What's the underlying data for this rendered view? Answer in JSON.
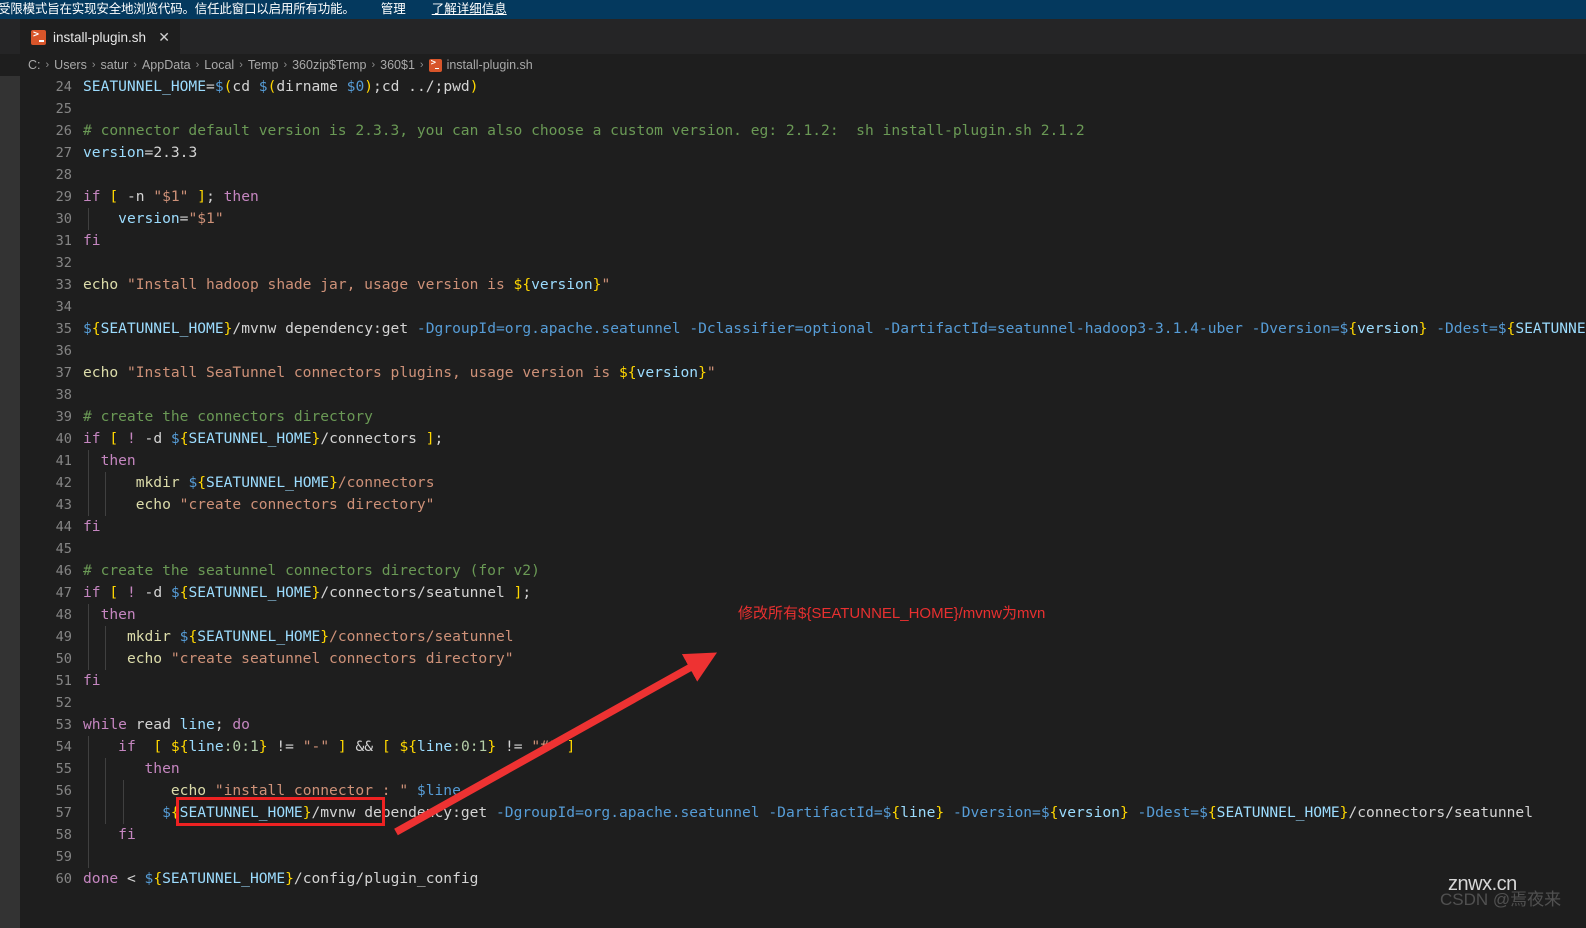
{
  "banner": {
    "message": "受限模式旨在实现安全地浏览代码。信任此窗口以启用所有功能。",
    "manage_label": "管理",
    "learn_more_label": "了解详细信息",
    "background_color": "#04395e"
  },
  "tab": {
    "label": "install-plugin.sh",
    "close_label": "✕",
    "icon": "shell-script-icon"
  },
  "breadcrumbs": {
    "separator": "›",
    "items": [
      {
        "label": "C:"
      },
      {
        "label": "Users"
      },
      {
        "label": "satur"
      },
      {
        "label": "AppData"
      },
      {
        "label": "Local"
      },
      {
        "label": "Temp"
      },
      {
        "label": "360zip$Temp"
      },
      {
        "label": "360$1"
      },
      {
        "label": "install-plugin.sh"
      }
    ]
  },
  "editor": {
    "first_line_number": 24,
    "background_color": "#1e1e1e",
    "lines": [
      {
        "n": 24,
        "tokens": [
          {
            "t": "SEATUNNEL_HOME",
            "c": "t-var"
          },
          {
            "t": "=",
            "c": "t-op"
          },
          {
            "t": "$",
            "c": "t-builtin"
          },
          {
            "t": "(",
            "c": "t-punc"
          },
          {
            "t": "cd ",
            "c": "t-def"
          },
          {
            "t": "$",
            "c": "t-builtin"
          },
          {
            "t": "(",
            "c": "t-punc"
          },
          {
            "t": "dirname ",
            "c": "t-def"
          },
          {
            "t": "$0",
            "c": "t-builtin"
          },
          {
            "t": ")",
            "c": "t-punc"
          },
          {
            "t": ";cd ../;pwd",
            "c": "t-def"
          },
          {
            "t": ")",
            "c": "t-punc"
          }
        ]
      },
      {
        "n": 25,
        "tokens": []
      },
      {
        "n": 26,
        "tokens": [
          {
            "t": "# connector default version is 2.3.3, you can also choose a custom version. eg: 2.1.2:  sh install-plugin.sh 2.1.2",
            "c": "t-cmt"
          }
        ]
      },
      {
        "n": 27,
        "tokens": [
          {
            "t": "version",
            "c": "t-var"
          },
          {
            "t": "=",
            "c": "t-op"
          },
          {
            "t": "2.3.3",
            "c": "t-def"
          }
        ]
      },
      {
        "n": 28,
        "tokens": []
      },
      {
        "n": 29,
        "tokens": [
          {
            "t": "if ",
            "c": "t-kw"
          },
          {
            "t": "[",
            "c": "t-punc"
          },
          {
            "t": " -n ",
            "c": "t-def"
          },
          {
            "t": "\"$1\"",
            "c": "t-str"
          },
          {
            "t": " ",
            "c": "t-def"
          },
          {
            "t": "]",
            "c": "t-punc"
          },
          {
            "t": "; ",
            "c": "t-def"
          },
          {
            "t": "then",
            "c": "t-kw"
          }
        ]
      },
      {
        "n": 30,
        "guides": [
          0
        ],
        "tokens": [
          {
            "t": "    ",
            "c": "t-def"
          },
          {
            "t": "version",
            "c": "t-var"
          },
          {
            "t": "=",
            "c": "t-op"
          },
          {
            "t": "\"$1\"",
            "c": "t-str"
          }
        ]
      },
      {
        "n": 31,
        "tokens": [
          {
            "t": "fi",
            "c": "t-kw"
          }
        ]
      },
      {
        "n": 32,
        "tokens": []
      },
      {
        "n": 33,
        "tokens": [
          {
            "t": "echo",
            "c": "t-fn"
          },
          {
            "t": " ",
            "c": "t-def"
          },
          {
            "t": "\"Install hadoop shade jar, usage version is ",
            "c": "t-str"
          },
          {
            "t": "${",
            "c": "t-punc"
          },
          {
            "t": "version",
            "c": "t-var"
          },
          {
            "t": "}",
            "c": "t-punc"
          },
          {
            "t": "\"",
            "c": "t-str"
          }
        ]
      },
      {
        "n": 34,
        "tokens": []
      },
      {
        "n": 35,
        "tokens": [
          {
            "t": "$",
            "c": "t-builtin"
          },
          {
            "t": "{",
            "c": "t-punc"
          },
          {
            "t": "SEATUNNEL_HOME",
            "c": "t-var"
          },
          {
            "t": "}",
            "c": "t-punc"
          },
          {
            "t": "/mvnw dependency:get ",
            "c": "t-def"
          },
          {
            "t": "-DgroupId=org.apache.seatunnel",
            "c": "t-builtin"
          },
          {
            "t": " ",
            "c": "t-def"
          },
          {
            "t": "-Dclassifier=optional",
            "c": "t-builtin"
          },
          {
            "t": " ",
            "c": "t-def"
          },
          {
            "t": "-DartifactId=seatunnel-hadoop3-3.1.4-uber",
            "c": "t-builtin"
          },
          {
            "t": " ",
            "c": "t-def"
          },
          {
            "t": "-Dversion=",
            "c": "t-builtin"
          },
          {
            "t": "$",
            "c": "t-builtin"
          },
          {
            "t": "{",
            "c": "t-punc"
          },
          {
            "t": "version",
            "c": "t-var"
          },
          {
            "t": "}",
            "c": "t-punc"
          },
          {
            "t": " ",
            "c": "t-def"
          },
          {
            "t": "-Ddest=",
            "c": "t-builtin"
          },
          {
            "t": "$",
            "c": "t-builtin"
          },
          {
            "t": "{",
            "c": "t-punc"
          },
          {
            "t": "SEATUNNE",
            "c": "t-var"
          }
        ]
      },
      {
        "n": 36,
        "tokens": []
      },
      {
        "n": 37,
        "tokens": [
          {
            "t": "echo",
            "c": "t-fn"
          },
          {
            "t": " ",
            "c": "t-def"
          },
          {
            "t": "\"Install SeaTunnel connectors plugins, usage version is ",
            "c": "t-str"
          },
          {
            "t": "${",
            "c": "t-punc"
          },
          {
            "t": "version",
            "c": "t-var"
          },
          {
            "t": "}",
            "c": "t-punc"
          },
          {
            "t": "\"",
            "c": "t-str"
          }
        ]
      },
      {
        "n": 38,
        "tokens": []
      },
      {
        "n": 39,
        "tokens": [
          {
            "t": "# create the connectors directory",
            "c": "t-cmt"
          }
        ]
      },
      {
        "n": 40,
        "tokens": [
          {
            "t": "if ",
            "c": "t-kw"
          },
          {
            "t": "[",
            "c": "t-punc"
          },
          {
            "t": " ",
            "c": "t-def"
          },
          {
            "t": "!",
            "c": "t-kw"
          },
          {
            "t": " -d ",
            "c": "t-def"
          },
          {
            "t": "$",
            "c": "t-builtin"
          },
          {
            "t": "{",
            "c": "t-punc"
          },
          {
            "t": "SEATUNNEL_HOME",
            "c": "t-var"
          },
          {
            "t": "}",
            "c": "t-punc"
          },
          {
            "t": "/connectors ",
            "c": "t-def"
          },
          {
            "t": "]",
            "c": "t-punc"
          },
          {
            "t": ";",
            "c": "t-def"
          }
        ]
      },
      {
        "n": 41,
        "guides": [
          0
        ],
        "tokens": [
          {
            "t": "  ",
            "c": "t-def"
          },
          {
            "t": "then",
            "c": "t-kw"
          }
        ]
      },
      {
        "n": 42,
        "guides": [
          0,
          1
        ],
        "tokens": [
          {
            "t": "      ",
            "c": "t-def"
          },
          {
            "t": "mkdir",
            "c": "t-fn"
          },
          {
            "t": " ",
            "c": "t-def"
          },
          {
            "t": "$",
            "c": "t-builtin"
          },
          {
            "t": "{",
            "c": "t-punc"
          },
          {
            "t": "SEATUNNEL_HOME",
            "c": "t-var"
          },
          {
            "t": "}",
            "c": "t-punc"
          },
          {
            "t": "/connectors",
            "c": "t-str"
          }
        ]
      },
      {
        "n": 43,
        "guides": [
          0,
          1
        ],
        "tokens": [
          {
            "t": "      ",
            "c": "t-def"
          },
          {
            "t": "echo",
            "c": "t-fn"
          },
          {
            "t": " ",
            "c": "t-def"
          },
          {
            "t": "\"create connectors directory\"",
            "c": "t-str"
          }
        ]
      },
      {
        "n": 44,
        "tokens": [
          {
            "t": "fi",
            "c": "t-kw"
          }
        ]
      },
      {
        "n": 45,
        "tokens": []
      },
      {
        "n": 46,
        "tokens": [
          {
            "t": "# create the seatunnel connectors directory (for v2)",
            "c": "t-cmt"
          }
        ]
      },
      {
        "n": 47,
        "tokens": [
          {
            "t": "if ",
            "c": "t-kw"
          },
          {
            "t": "[",
            "c": "t-punc"
          },
          {
            "t": " ",
            "c": "t-def"
          },
          {
            "t": "!",
            "c": "t-kw"
          },
          {
            "t": " -d ",
            "c": "t-def"
          },
          {
            "t": "$",
            "c": "t-builtin"
          },
          {
            "t": "{",
            "c": "t-punc"
          },
          {
            "t": "SEATUNNEL_HOME",
            "c": "t-var"
          },
          {
            "t": "}",
            "c": "t-punc"
          },
          {
            "t": "/connectors/seatunnel ",
            "c": "t-def"
          },
          {
            "t": "]",
            "c": "t-punc"
          },
          {
            "t": ";",
            "c": "t-def"
          }
        ]
      },
      {
        "n": 48,
        "guides": [
          0
        ],
        "tokens": [
          {
            "t": "  ",
            "c": "t-def"
          },
          {
            "t": "then",
            "c": "t-kw"
          }
        ]
      },
      {
        "n": 49,
        "guides": [
          0,
          1
        ],
        "tokens": [
          {
            "t": "     ",
            "c": "t-def"
          },
          {
            "t": "mkdir",
            "c": "t-fn"
          },
          {
            "t": " ",
            "c": "t-def"
          },
          {
            "t": "$",
            "c": "t-builtin"
          },
          {
            "t": "{",
            "c": "t-punc"
          },
          {
            "t": "SEATUNNEL_HOME",
            "c": "t-var"
          },
          {
            "t": "}",
            "c": "t-punc"
          },
          {
            "t": "/connectors/seatunnel",
            "c": "t-str"
          }
        ]
      },
      {
        "n": 50,
        "guides": [
          0,
          1
        ],
        "tokens": [
          {
            "t": "     ",
            "c": "t-def"
          },
          {
            "t": "echo",
            "c": "t-fn"
          },
          {
            "t": " ",
            "c": "t-def"
          },
          {
            "t": "\"create seatunnel connectors directory\"",
            "c": "t-str"
          }
        ]
      },
      {
        "n": 51,
        "tokens": [
          {
            "t": "fi",
            "c": "t-kw"
          }
        ]
      },
      {
        "n": 52,
        "tokens": []
      },
      {
        "n": 53,
        "tokens": [
          {
            "t": "while",
            "c": "t-kw"
          },
          {
            "t": " read ",
            "c": "t-def"
          },
          {
            "t": "line",
            "c": "t-var"
          },
          {
            "t": "; ",
            "c": "t-def"
          },
          {
            "t": "do",
            "c": "t-kw"
          }
        ]
      },
      {
        "n": 54,
        "guides": [
          0
        ],
        "tokens": [
          {
            "t": "    ",
            "c": "t-def"
          },
          {
            "t": "if",
            "c": "t-kw"
          },
          {
            "t": "  ",
            "c": "t-def"
          },
          {
            "t": "[",
            "c": "t-punc"
          },
          {
            "t": " ",
            "c": "t-def"
          },
          {
            "t": "${",
            "c": "t-punc"
          },
          {
            "t": "line",
            "c": "t-var"
          },
          {
            "t": ":0:1",
            "c": "t-num"
          },
          {
            "t": "}",
            "c": "t-punc"
          },
          {
            "t": " != ",
            "c": "t-def"
          },
          {
            "t": "\"-\"",
            "c": "t-str"
          },
          {
            "t": " ",
            "c": "t-def"
          },
          {
            "t": "]",
            "c": "t-punc"
          },
          {
            "t": " ",
            "c": "t-def"
          },
          {
            "t": "&&",
            "c": "t-def"
          },
          {
            "t": " ",
            "c": "t-def"
          },
          {
            "t": "[",
            "c": "t-punc"
          },
          {
            "t": " ",
            "c": "t-def"
          },
          {
            "t": "${",
            "c": "t-punc"
          },
          {
            "t": "line",
            "c": "t-var"
          },
          {
            "t": ":0:1",
            "c": "t-num"
          },
          {
            "t": "}",
            "c": "t-punc"
          },
          {
            "t": " != ",
            "c": "t-def"
          },
          {
            "t": "\"#\"",
            "c": "t-str"
          },
          {
            "t": " ",
            "c": "t-def"
          },
          {
            "t": "]",
            "c": "t-punc"
          }
        ]
      },
      {
        "n": 55,
        "guides": [
          0,
          1
        ],
        "tokens": [
          {
            "t": "       ",
            "c": "t-def"
          },
          {
            "t": "then",
            "c": "t-kw"
          }
        ]
      },
      {
        "n": 56,
        "guides": [
          0,
          1,
          2
        ],
        "tokens": [
          {
            "t": "          ",
            "c": "t-def"
          },
          {
            "t": "echo",
            "c": "t-fn"
          },
          {
            "t": " ",
            "c": "t-def"
          },
          {
            "t": "\"install connector : \"",
            "c": "t-str"
          },
          {
            "t": " ",
            "c": "t-def"
          },
          {
            "t": "$line",
            "c": "t-builtin"
          }
        ]
      },
      {
        "n": 57,
        "guides": [
          0,
          1,
          2
        ],
        "tokens": [
          {
            "t": "         ",
            "c": "t-def"
          },
          {
            "t": "$",
            "c": "t-builtin"
          },
          {
            "t": "{",
            "c": "t-punc"
          },
          {
            "t": "SEATUNNEL_HOME",
            "c": "t-var"
          },
          {
            "t": "}",
            "c": "t-punc"
          },
          {
            "t": "/mvnw dependency:get ",
            "c": "t-def"
          },
          {
            "t": "-DgroupId=org.apache.seatunnel",
            "c": "t-builtin"
          },
          {
            "t": " ",
            "c": "t-def"
          },
          {
            "t": "-DartifactId=",
            "c": "t-builtin"
          },
          {
            "t": "$",
            "c": "t-builtin"
          },
          {
            "t": "{",
            "c": "t-punc"
          },
          {
            "t": "line",
            "c": "t-var"
          },
          {
            "t": "}",
            "c": "t-punc"
          },
          {
            "t": " ",
            "c": "t-def"
          },
          {
            "t": "-Dversion=",
            "c": "t-builtin"
          },
          {
            "t": "$",
            "c": "t-builtin"
          },
          {
            "t": "{",
            "c": "t-punc"
          },
          {
            "t": "version",
            "c": "t-var"
          },
          {
            "t": "}",
            "c": "t-punc"
          },
          {
            "t": " ",
            "c": "t-def"
          },
          {
            "t": "-Ddest=",
            "c": "t-builtin"
          },
          {
            "t": "$",
            "c": "t-builtin"
          },
          {
            "t": "{",
            "c": "t-punc"
          },
          {
            "t": "SEATUNNEL_HOME",
            "c": "t-var"
          },
          {
            "t": "}",
            "c": "t-punc"
          },
          {
            "t": "/connectors/seatunnel",
            "c": "t-def"
          }
        ]
      },
      {
        "n": 58,
        "guides": [
          0
        ],
        "tokens": [
          {
            "t": "    ",
            "c": "t-def"
          },
          {
            "t": "fi",
            "c": "t-kw"
          }
        ]
      },
      {
        "n": 59,
        "guides": [
          0
        ],
        "tokens": []
      },
      {
        "n": 60,
        "tokens": [
          {
            "t": "done",
            "c": "t-kw"
          },
          {
            "t": " < ",
            "c": "t-def"
          },
          {
            "t": "$",
            "c": "t-builtin"
          },
          {
            "t": "{",
            "c": "t-punc"
          },
          {
            "t": "SEATUNNEL_HOME",
            "c": "t-var"
          },
          {
            "t": "}",
            "c": "t-punc"
          },
          {
            "t": "/config/plugin_config",
            "c": "t-def"
          }
        ]
      }
    ]
  },
  "annotations": {
    "note_text": "修改所有${SEATUNNEL_HOME}/mvnw为mvn",
    "note_color": "#e83030",
    "arrow_color": "#ee3232",
    "highlight_box_color": "#ee2222",
    "highlight_target": "${SEATUNNEL_HOME}/mvnw"
  },
  "watermark": {
    "primary": "znwx.cn",
    "secondary": "CSDN @焉夜来"
  }
}
